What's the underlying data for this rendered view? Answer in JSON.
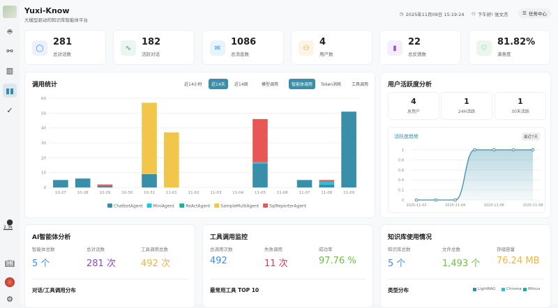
{
  "app": {
    "title": "Yuxi-Know",
    "subtitle": "大模型驱动的知识库智能体平台"
  },
  "header": {
    "datetime": "2025年11月09日 15:19:24",
    "greeting": "下午好! 张文杰",
    "task_center": "任务中心"
  },
  "sidebar": {
    "github_stars": "2.3k",
    "items": [
      "robot-icon",
      "graph-icon",
      "library-icon",
      "dashboard-icon",
      "check-icon"
    ]
  },
  "stats": [
    {
      "value": "281",
      "label": "总对话数",
      "icon": "chat-icon",
      "color": "#3b82f6",
      "bg": "#eaf2fe"
    },
    {
      "value": "182",
      "label": "活跃对话",
      "icon": "activity-icon",
      "color": "#22a35a",
      "bg": "#e9f7ee"
    },
    {
      "value": "1086",
      "label": "总消息数",
      "icon": "mail-icon",
      "color": "#2f8fd0",
      "bg": "#e8f4fb"
    },
    {
      "value": "4",
      "label": "用户数",
      "icon": "users-icon",
      "color": "#e0912b",
      "bg": "#fdf4e6"
    },
    {
      "value": "22",
      "label": "总反馈数",
      "icon": "bar-chart-icon",
      "color": "#9b59d0",
      "bg": "#f5eefc"
    },
    {
      "value": "81.82%",
      "label": "满意度",
      "icon": "heart-icon",
      "color": "#22a35a",
      "bg": "#e9f7ee"
    }
  ],
  "usage": {
    "title": "调用统计",
    "time_tabs": [
      "近14小时",
      "近14天",
      "近14周"
    ],
    "type_tabs": [
      "模型调用",
      "智能体调用",
      "Token消耗",
      "工具调用"
    ],
    "active_time": 1,
    "active_type": 1
  },
  "chart_data": [
    {
      "type": "bar",
      "stacked": true,
      "categories": [
        "10-27",
        "10-28",
        "10-29",
        "10-30",
        "10-31",
        "11-01",
        "11-02",
        "11-03",
        "11-04",
        "11-05",
        "11-06",
        "11-07",
        "11-08",
        "11-09"
      ],
      "ylim": [
        0,
        60
      ],
      "yticks": [
        0,
        10,
        20,
        30,
        40,
        50,
        60
      ],
      "grid": true,
      "legend": "bottom",
      "series": [
        {
          "name": "ChatbotAgent",
          "color": "#3a8fa8",
          "values": [
            5,
            6,
            1,
            0,
            9,
            0,
            0,
            0,
            0,
            16,
            0,
            5,
            2,
            51
          ]
        },
        {
          "name": "MiniAgent",
          "color": "#22c3dc",
          "values": [
            0,
            0,
            0,
            0,
            0,
            0,
            0,
            0,
            0,
            1,
            0,
            0,
            2,
            0
          ]
        },
        {
          "name": "ReActAgent",
          "color": "#14b39a",
          "values": [
            0,
            0,
            0,
            0,
            0,
            0,
            0,
            0,
            0,
            0,
            0,
            0,
            0,
            0
          ]
        },
        {
          "name": "SampleMultiAgent",
          "color": "#f2c54b",
          "values": [
            0,
            0,
            0,
            0,
            48,
            37,
            0,
            0,
            0,
            0,
            0,
            0,
            0,
            0
          ]
        },
        {
          "name": "SqlReporterAgent",
          "color": "#e85656",
          "values": [
            0,
            0,
            1,
            0,
            0,
            0,
            0,
            0,
            0,
            29,
            0,
            0,
            1,
            0
          ]
        }
      ]
    },
    {
      "type": "line",
      "title": "活跃度趋势",
      "badge": "最近7天",
      "x": [
        "2025-11-02",
        "2025-11-03",
        "2025-11-04",
        "2025-11-05",
        "2025-11-06",
        "2025-11-07",
        "2025-11-08"
      ],
      "xticks": [
        "2025-11-02",
        "2025-11-04",
        "2025-11-06",
        "2025-11-08"
      ],
      "values": [
        0,
        0,
        0,
        1,
        1,
        1,
        1
      ],
      "ylim": [
        0,
        1
      ],
      "yticks": [
        "0",
        "0.2",
        "0.4",
        "0.6",
        "0.8",
        "1"
      ],
      "color": "#3a8fa8",
      "area": true
    }
  ],
  "activity": {
    "title": "用户活跃度分析",
    "cards": [
      {
        "value": "4",
        "label": "总用户"
      },
      {
        "value": "1",
        "label": "24H活跃"
      },
      {
        "value": "1",
        "label": "30天活跃"
      }
    ]
  },
  "ai": {
    "title": "AI智能体分析",
    "metrics": [
      {
        "label": "智能体总数",
        "value": "5 个",
        "color": "#3b8cf0"
      },
      {
        "label": "总对话数",
        "value": "281 次",
        "color": "#8e44d0"
      },
      {
        "label": "工具调用总数",
        "value": "492 次",
        "color": "#f2b53c"
      }
    ],
    "section": "对话/工具调用分布"
  },
  "tools": {
    "title": "工具调用监控",
    "metrics": [
      {
        "label": "总调用次数",
        "value": "492",
        "color": "#3b8cf0"
      },
      {
        "label": "失败调用",
        "value": "11 次",
        "color": "#e8334a"
      },
      {
        "label": "成功率",
        "value": "97.76 %",
        "color": "#6cc04a"
      }
    ],
    "section": "最常用工具 TOP 10"
  },
  "kb": {
    "title": "知识库使用情况",
    "metrics": [
      {
        "label": "知识库总数",
        "value": "5 个",
        "color": "#3b8cf0"
      },
      {
        "label": "文件总数",
        "value": "1,493 个",
        "color": "#6cc04a"
      },
      {
        "label": "存储容量",
        "value": "76.24 MB",
        "color": "#f2b53c"
      }
    ],
    "section": "类型分布",
    "legend": [
      {
        "name": "LightRAG",
        "color": "#3a8fa8"
      },
      {
        "name": "Chroma",
        "color": "#22c3dc"
      },
      {
        "name": "Milvus",
        "color": "#14b39a"
      }
    ]
  }
}
